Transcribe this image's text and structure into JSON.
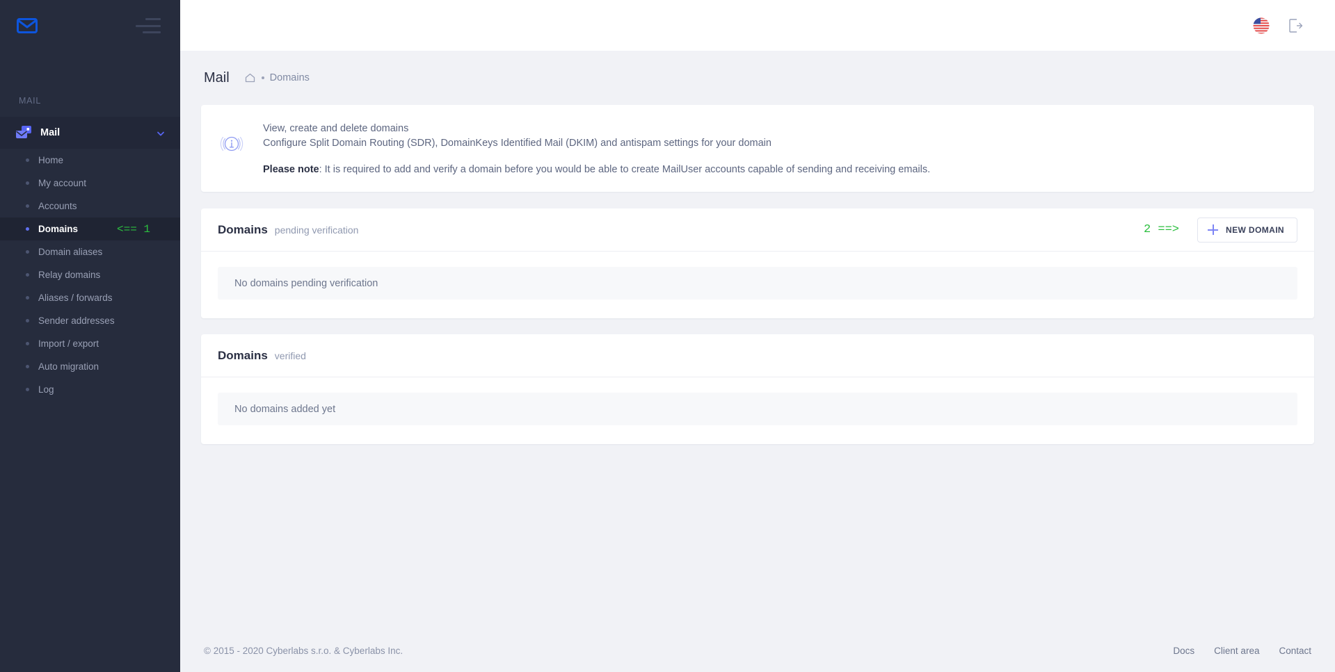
{
  "sidebar": {
    "brand_icon": "envelope-icon",
    "menu_icon": "hamburger-icon",
    "section_label": "MAIL",
    "group": {
      "icon": "mail-stack-icon",
      "title": "Mail",
      "chevron": "chevron-down-icon"
    },
    "items": [
      {
        "label": "Home",
        "active": false,
        "note": ""
      },
      {
        "label": "My account",
        "active": false,
        "note": ""
      },
      {
        "label": "Accounts",
        "active": false,
        "note": ""
      },
      {
        "label": "Domains",
        "active": true,
        "note": "<== 1"
      },
      {
        "label": "Domain aliases",
        "active": false,
        "note": ""
      },
      {
        "label": "Relay domains",
        "active": false,
        "note": ""
      },
      {
        "label": "Aliases / forwards",
        "active": false,
        "note": ""
      },
      {
        "label": "Sender addresses",
        "active": false,
        "note": ""
      },
      {
        "label": "Import / export",
        "active": false,
        "note": ""
      },
      {
        "label": "Auto migration",
        "active": false,
        "note": ""
      },
      {
        "label": "Log",
        "active": false,
        "note": ""
      }
    ]
  },
  "topbar": {
    "language_icon": "us-flag-icon",
    "logout_icon": "logout-icon"
  },
  "breadcrumb": {
    "title": "Mail",
    "home_icon": "home-icon",
    "current": "Domains"
  },
  "banner": {
    "icon": "info-icon",
    "line1": "View, create and delete domains",
    "line2": "Configure Split Domain Routing (SDR), DomainKeys Identified Mail (DKIM) and antispam settings for your domain",
    "note_label": "Please note",
    "note_text": ": It is required to add and verify a domain before you would be able to create MailUser accounts capable of sending and receiving emails."
  },
  "pending_card": {
    "title": "Domains",
    "subtitle": "pending verification",
    "annotation": "2 ==>",
    "new_button_label": "NEW DOMAIN",
    "new_button_icon": "plus-icon",
    "empty_text": "No domains pending verification"
  },
  "verified_card": {
    "title": "Domains",
    "subtitle": "verified",
    "empty_text": "No domains added yet"
  },
  "footer": {
    "copyright": "© 2015 - 2020 Cyberlabs s.r.o. & Cyberlabs Inc.",
    "links": [
      {
        "label": "Docs"
      },
      {
        "label": "Client area"
      },
      {
        "label": "Contact"
      }
    ]
  },
  "colors": {
    "sidebar_bg": "#262c3d",
    "sidebar_active_bg": "#1f2433",
    "accent": "#6070f0",
    "annotation_green": "#2cbf3f",
    "page_bg": "#f1f2f6",
    "text_dark": "#2b3044",
    "text_muted": "#8a92a8"
  }
}
